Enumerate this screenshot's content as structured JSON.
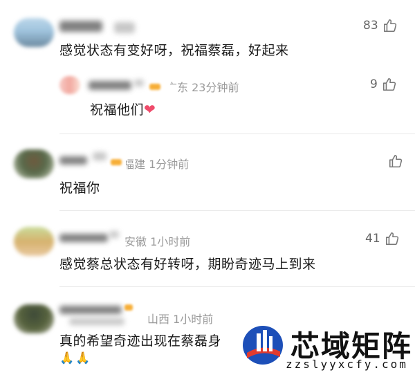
{
  "comments": [
    {
      "text": "感觉状态有变好呀，祝福蔡磊，好起来",
      "likes": "83",
      "reply": {
        "meta": "广东 23分钟前",
        "text": "祝福他们",
        "emoji": "❤",
        "likes": "9"
      }
    },
    {
      "meta": "福建 1分钟前",
      "text": "祝福你",
      "likes": ""
    },
    {
      "meta": "安徽 1小时前",
      "text": "感觉蔡总状态有好转呀，期盼奇迹马上到来",
      "likes": "41"
    },
    {
      "meta": "山西 1小时前",
      "text": "真的希望奇迹出现在蔡磊身",
      "emoji": "🙏🙏"
    }
  ],
  "watermark": {
    "title": "芯域矩阵",
    "url": "zzslyyxcfy.com"
  },
  "colors": {
    "meta": "#9a9a9a",
    "text": "#1a1a1a",
    "divider": "#e9e9e9",
    "heart": "#ef4b6b",
    "logo_blue": "#1d4fb8",
    "logo_red": "#e23b2e"
  },
  "icons": [
    "thumbs-up-icon",
    "heart-icon",
    "folded-hands-icon"
  ]
}
